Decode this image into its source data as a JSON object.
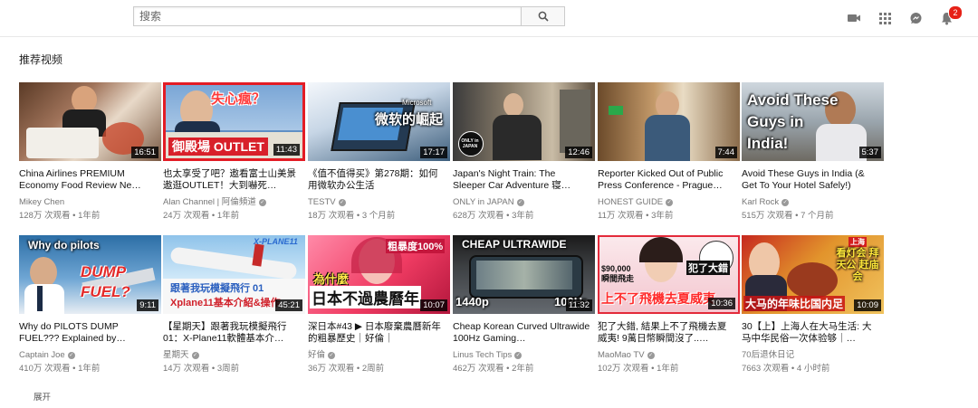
{
  "search": {
    "placeholder": "搜索"
  },
  "notifications": {
    "count": "2"
  },
  "section": {
    "title": "推荐视频",
    "expand_label": "展开"
  },
  "videos": [
    {
      "title": "China Airlines PREMIUM Economy Food Review Ne…",
      "channel": "Mikey Chen",
      "verified": false,
      "views": "128万 次观看",
      "age": "1年前",
      "duration": "16:51",
      "overlay": ""
    },
    {
      "title": "也太享受了吧？遨看富士山美景遨逛OUTLET！大到嚇死…",
      "channel": "Alan Channel | 阿倫頻道",
      "verified": true,
      "views": "24万 次观看",
      "age": "1年前",
      "duration": "11:43",
      "overlay": "失心瘋？",
      "overlay2": "御殿場 OUTLET"
    },
    {
      "title": "《值不值得买》第278期：如何用微软办公生活",
      "channel": "TESTV",
      "verified": true,
      "views": "18万 次观看",
      "age": "3 个月前",
      "duration": "17:17",
      "overlay": "微软的崛起",
      "overlay2": "Microsoft"
    },
    {
      "title": "Japan's Night Train: The Sleeper Car Adventure 寝…",
      "channel": "ONLY in JAPAN",
      "verified": true,
      "views": "628万 次观看",
      "age": "3年前",
      "duration": "12:46",
      "overlay": "ONLY in JAPAN"
    },
    {
      "title": "Reporter Kicked Out of Public Press Conference - Prague…",
      "channel": "HONEST GUIDE",
      "verified": true,
      "views": "11万 次观看",
      "age": "3年前",
      "duration": "7:44",
      "overlay": ""
    },
    {
      "title": "Avoid These Guys in India (& Get To Your Hotel Safely!)",
      "channel": "Karl Rock",
      "verified": true,
      "views": "515万 次观看",
      "age": "7 个月前",
      "duration": "5:37",
      "overlay": "Avoid These Guys in India!"
    },
    {
      "title": "Why do PILOTS DUMP FUEL??? Explained by…",
      "channel": "Captain Joe",
      "verified": true,
      "views": "410万 次观看",
      "age": "1年前",
      "duration": "9:11",
      "overlay": "Why do pilots",
      "overlay2": "DUMP FUEL?"
    },
    {
      "title": "【星期天】跟著我玩模擬飛行01：X-Plane11軟體基本介…",
      "channel": "星期天",
      "verified": true,
      "views": "14万 次观看",
      "age": "3周前",
      "duration": "45:21",
      "overlay": "跟著我玩模擬飛行 01",
      "overlay2": "Xplane11基本介紹&操作"
    },
    {
      "title": "深日本#43 ▶ 日本廢棄農曆新年的粗暴歷史｜好倫｜",
      "channel": "好倫",
      "verified": true,
      "views": "36万 次观看",
      "age": "2周前",
      "duration": "10:07",
      "overlay": "日本不過農曆年",
      "overlay2": "為什麼",
      "overlay3": "粗暴度100%"
    },
    {
      "title": "Cheap Korean Curved Ultrawide 100Hz Gaming…",
      "channel": "Linus Tech Tips",
      "verified": true,
      "views": "462万 次观看",
      "age": "2年前",
      "duration": "11:32",
      "overlay": "CHEAP ULTRAWIDE",
      "overlay2": "1440p",
      "overlay3": "100Hz"
    },
    {
      "title": "犯了大錯, 結果上不了飛機去夏威夷! 9萬日幣瞬間沒了..…",
      "channel": "MaoMao TV",
      "verified": true,
      "views": "102万 次观看",
      "age": "1年前",
      "duration": "10:36",
      "overlay": "上不了飛機去夏威夷",
      "overlay2": "$90,000 瞬間飛走",
      "overlay3": "犯了大錯"
    },
    {
      "title": "30【上】上海人在大马生活: 大马中华民俗一次体验够｜…",
      "channel": "70后退休日记",
      "verified": false,
      "views": "7663 次观看",
      "age": "4 小时前",
      "duration": "10:09",
      "overlay": "大马的年味比国内足",
      "overlay2": "看灯会 拜天公 赶庙会",
      "overlay3": "上海"
    }
  ],
  "colors": {
    "accent": "#e62117",
    "muted": "#767676"
  }
}
